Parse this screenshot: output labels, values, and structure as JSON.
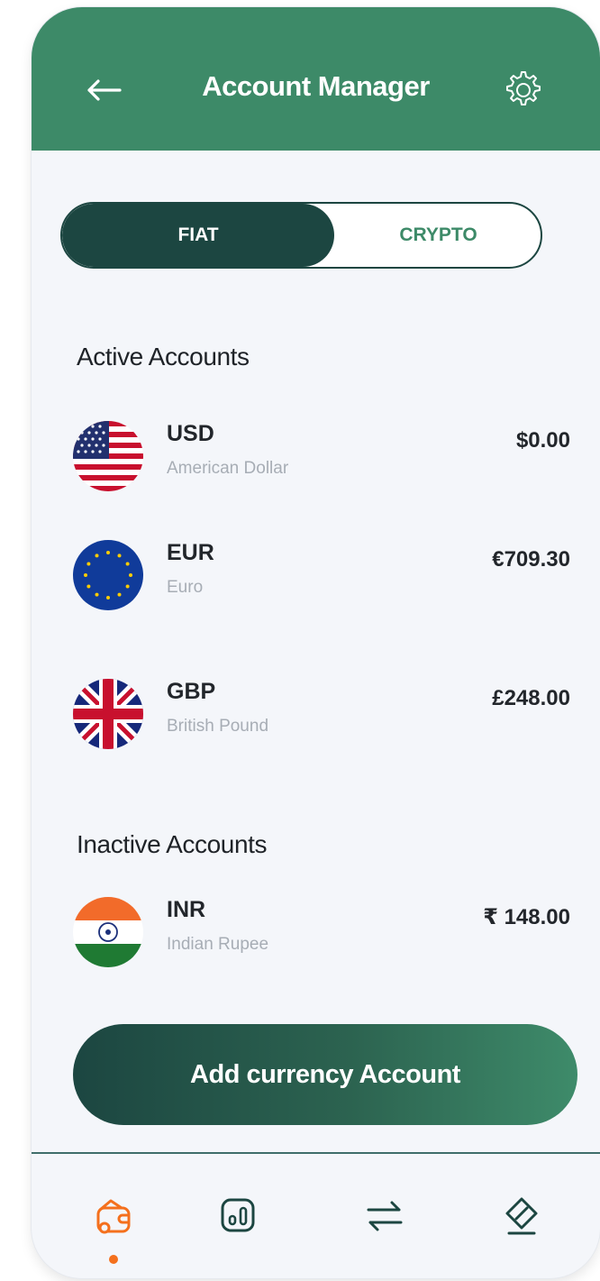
{
  "header": {
    "title": "Account Manager",
    "back_icon": "arrow-left-icon",
    "settings_icon": "gear-icon",
    "background_color": "#3d8a68"
  },
  "tabs": {
    "items": [
      {
        "label": "FIAT",
        "active": true
      },
      {
        "label": "CRYPTO",
        "active": false
      }
    ],
    "active_color": "#1c4641"
  },
  "active_section": {
    "title": "Active Accounts",
    "accounts": [
      {
        "code": "USD",
        "name": "American Dollar",
        "amount": "$0.00",
        "flag_icon": "us-flag-icon"
      },
      {
        "code": "EUR",
        "name": "Euro",
        "amount": "€709.30",
        "flag_icon": "eu-flag-icon"
      },
      {
        "code": "GBP",
        "name": "British Pound",
        "amount": "£248.00",
        "flag_icon": "uk-flag-icon"
      }
    ]
  },
  "inactive_section": {
    "title": "Inactive Accounts",
    "accounts": [
      {
        "code": "INR",
        "name": "Indian Rupee",
        "amount": "₹ 148.00",
        "flag_icon": "india-flag-icon"
      }
    ]
  },
  "add_button": {
    "label": "Add currency Account"
  },
  "bottom_nav": {
    "items": [
      {
        "icon": "wallet-icon",
        "active": true
      },
      {
        "icon": "chart-icon",
        "active": false
      },
      {
        "icon": "transfer-icon",
        "active": false
      },
      {
        "icon": "tag-icon",
        "active": false
      }
    ],
    "active_color": "#f4701d",
    "inactive_color": "#1c4641"
  }
}
